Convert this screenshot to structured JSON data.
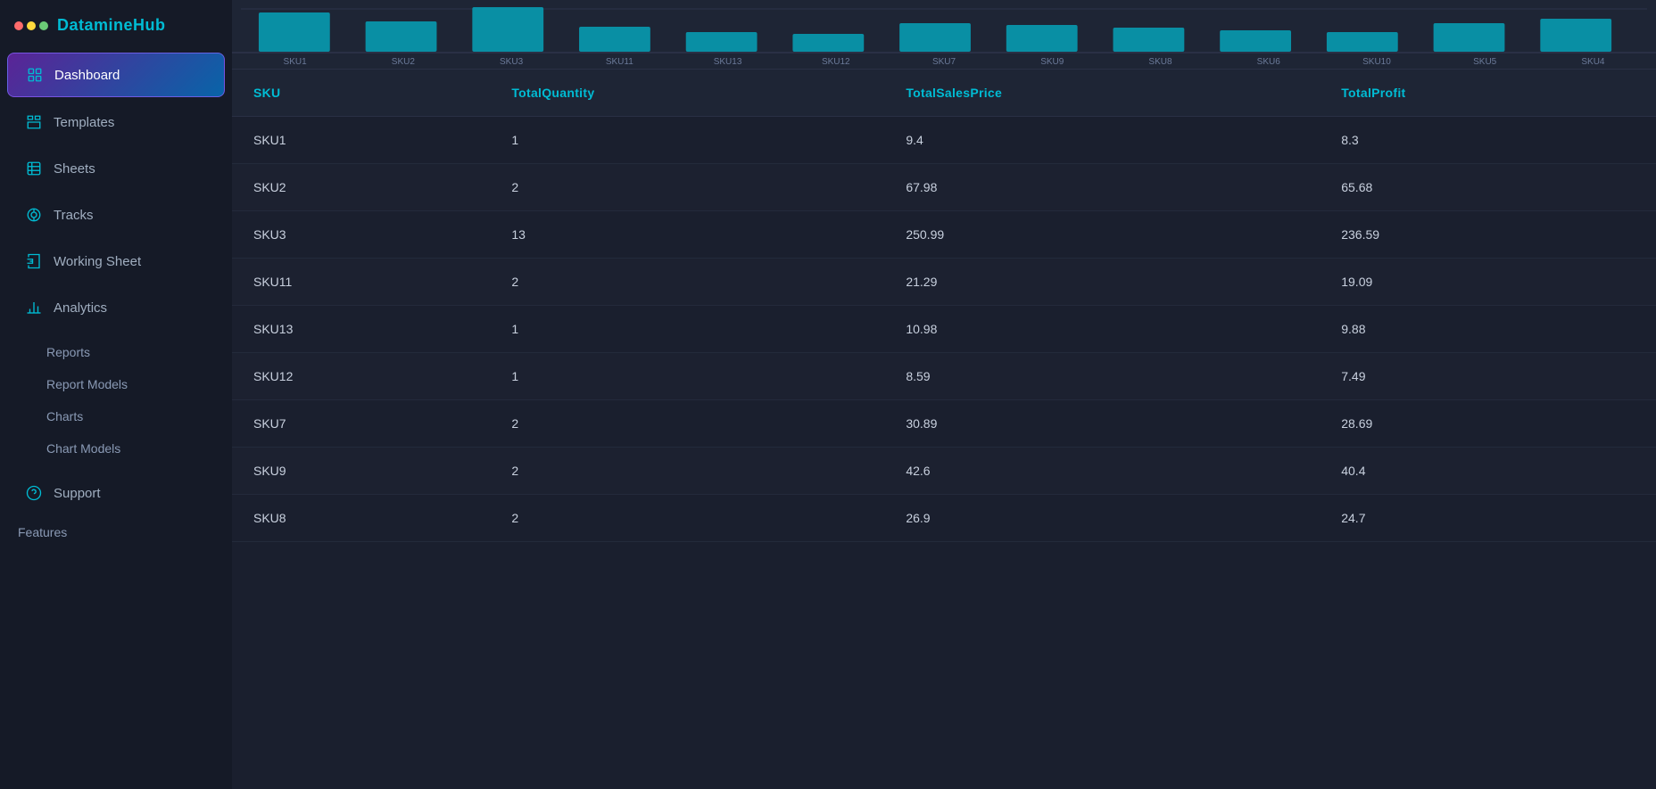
{
  "logo": {
    "text": "DatamineHub",
    "dots": [
      "#ff6b6b",
      "#ffd93d",
      "#6bcb77"
    ]
  },
  "nav": {
    "dashboard_label": "Dashboard",
    "templates_label": "Templates",
    "sheets_label": "Sheets",
    "tracks_label": "Tracks",
    "working_sheet_label": "Working Sheet",
    "analytics_label": "Analytics",
    "reports_label": "Reports",
    "report_models_label": "Report Models",
    "charts_label": "Charts",
    "chart_models_label": "Chart Models",
    "support_label": "Support",
    "features_label": "Features"
  },
  "table": {
    "columns": [
      {
        "key": "sku",
        "label": "SKU"
      },
      {
        "key": "totalQuantity",
        "label": "TotalQuantity"
      },
      {
        "key": "totalSalesPrice",
        "label": "TotalSalesPrice"
      },
      {
        "key": "totalProfit",
        "label": "TotalProfit"
      }
    ],
    "rows": [
      {
        "sku": "SKU1",
        "totalQuantity": "1",
        "totalSalesPrice": "9.4",
        "totalProfit": "8.3"
      },
      {
        "sku": "SKU2",
        "totalQuantity": "2",
        "totalSalesPrice": "67.98",
        "totalProfit": "65.68"
      },
      {
        "sku": "SKU3",
        "totalQuantity": "13",
        "totalSalesPrice": "250.99",
        "totalProfit": "236.59"
      },
      {
        "sku": "SKU11",
        "totalQuantity": "2",
        "totalSalesPrice": "21.29",
        "totalProfit": "19.09"
      },
      {
        "sku": "SKU13",
        "totalQuantity": "1",
        "totalSalesPrice": "10.98",
        "totalProfit": "9.88"
      },
      {
        "sku": "SKU12",
        "totalQuantity": "1",
        "totalSalesPrice": "8.59",
        "totalProfit": "7.49"
      },
      {
        "sku": "SKU7",
        "totalQuantity": "2",
        "totalSalesPrice": "30.89",
        "totalProfit": "28.69"
      },
      {
        "sku": "SKU9",
        "totalQuantity": "2",
        "totalSalesPrice": "42.6",
        "totalProfit": "40.4"
      },
      {
        "sku": "SKU8",
        "totalQuantity": "2",
        "totalSalesPrice": "26.9",
        "totalProfit": "24.7"
      }
    ]
  },
  "chart": {
    "x_labels": [
      "SKU1",
      "SKU2",
      "SKU3",
      "SKU11",
      "SKU13",
      "SKU12",
      "SKU7",
      "SKU9",
      "SKU8",
      "SKU6",
      "SKU10",
      "SKU5",
      "SKU4"
    ]
  }
}
